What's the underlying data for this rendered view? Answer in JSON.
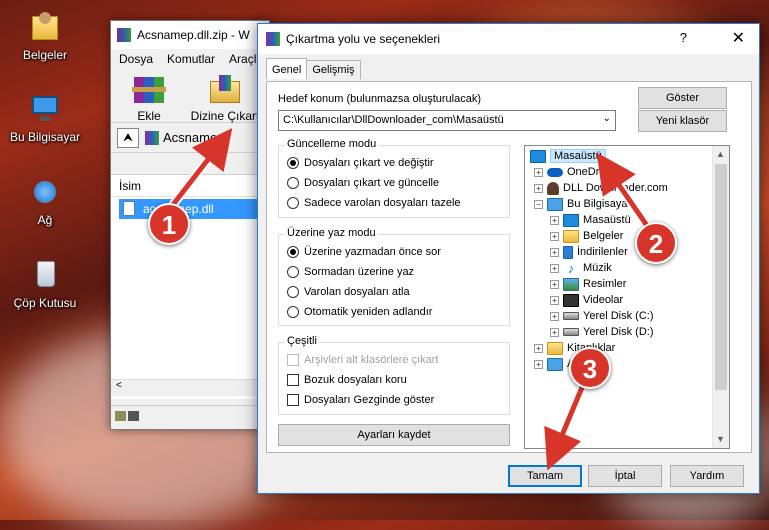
{
  "desktop": {
    "icons": [
      {
        "label": "Belgeler",
        "icon": "folder-user-icon"
      },
      {
        "label": "Bu Bilgisayar",
        "icon": "computer-icon"
      },
      {
        "label": "Ağ",
        "icon": "network-icon"
      },
      {
        "label": "Çöp Kutusu",
        "icon": "recycle-bin-icon"
      }
    ]
  },
  "winrar": {
    "title": "Acsnamep.dll.zip - W",
    "menu": [
      "Dosya",
      "Komutlar",
      "Araçla"
    ],
    "toolbar": {
      "add": "Ekle",
      "extract": "Dizine Çıkart"
    },
    "path": "Acsnamep",
    "column_name": "İsim",
    "file": "acsnamep.dll",
    "scroll_left": "<"
  },
  "dialog": {
    "title": "Çıkartma yolu ve seçenekleri",
    "help": "?",
    "close": "✕",
    "tabs": [
      "Genel",
      "Gelişmiş"
    ],
    "dest_label": "Hedef konum (bulunmazsa oluşturulacak)",
    "dest_value": "C:\\Kullanıcılar\\DllDownloader_com\\Masaüstü",
    "show_button": "Göster",
    "new_folder_button": "Yeni klasör",
    "update_mode": {
      "title": "Güncelleme modu",
      "options": [
        "Dosyaları çıkart ve değiştir",
        "Dosyaları çıkart ve güncelle",
        "Sadece varolan dosyaları tazele"
      ],
      "selected": 0
    },
    "overwrite_mode": {
      "title": "Üzerine yaz modu",
      "options": [
        "Üzerine yazmadan önce sor",
        "Sormadan üzerine yaz",
        "Varolan dosyaları atla",
        "Otomatik yeniden adlandır"
      ],
      "selected": 0
    },
    "misc": {
      "title": "Çeşitli",
      "options": [
        "Arşivleri alt klasörlere çıkart",
        "Bozuk dosyaları koru",
        "Dosyaları Gezginde göster"
      ]
    },
    "save_settings": "Ayarları kaydet",
    "tree": [
      {
        "label": "Masaüstü",
        "icon": "desktop-icon",
        "expander": "",
        "selected": true
      },
      {
        "label": "OneDri",
        "icon": "onedrive-icon",
        "expander": "+"
      },
      {
        "label": "DLL Downloader.com",
        "icon": "user-icon",
        "expander": "+"
      },
      {
        "label": "Bu Bilgisaya",
        "icon": "computer-icon",
        "expander": "−"
      },
      {
        "label": "Masaüstü",
        "icon": "desktop-icon",
        "expander": "+"
      },
      {
        "label": "Belgeler",
        "icon": "folder-icon",
        "expander": "+"
      },
      {
        "label": "İndirilenler",
        "icon": "downloads-icon",
        "expander": "+"
      },
      {
        "label": "Müzik",
        "icon": "music-icon",
        "expander": "+"
      },
      {
        "label": "Resimler",
        "icon": "pictures-icon",
        "expander": "+"
      },
      {
        "label": "Videolar",
        "icon": "video-icon",
        "expander": "+"
      },
      {
        "label": "Yerel Disk (C:)",
        "icon": "drive-icon",
        "expander": "+"
      },
      {
        "label": "Yerel Disk (D:)",
        "icon": "drive-icon",
        "expander": "+"
      },
      {
        "label": "Kitaplıklar",
        "icon": "library-icon",
        "expander": "+"
      },
      {
        "label": "A",
        "icon": "network-icon",
        "expander": "+"
      }
    ],
    "buttons": {
      "ok": "Tamam",
      "cancel": "İptal",
      "help": "Yardım"
    }
  },
  "callouts": [
    "1",
    "2",
    "3"
  ],
  "colors": {
    "callout": "#d8352a",
    "accent": "#0078d7",
    "selection": "#3399ff"
  }
}
